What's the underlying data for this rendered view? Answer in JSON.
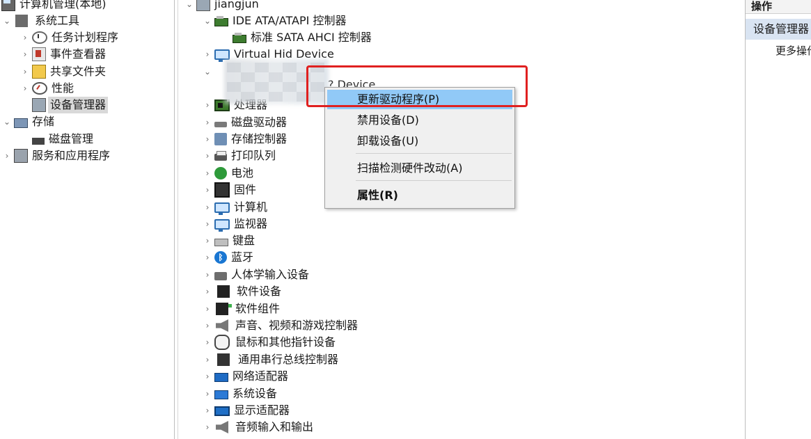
{
  "left_tree": {
    "root": "计算机管理(本地)",
    "system_tools": "系统工具",
    "task_scheduler": "任务计划程序",
    "event_viewer": "事件查看器",
    "shared_folders": "共享文件夹",
    "performance": "性能",
    "device_manager": "设备管理器",
    "storage": "存储",
    "disk_management": "磁盘管理",
    "services_apps": "服务和应用程序"
  },
  "device_tree": {
    "computer_name": "jiangjun",
    "ide_controller": "IDE ATA/ATAPI 控制器",
    "sata_controller": "标准 SATA AHCI 控制器",
    "virtual_hid": "Virtual Hid Device",
    "partial_device_text": "? Device",
    "processor_partial": "处理器",
    "categories": [
      "磁盘驱动器",
      "存储控制器",
      "打印队列",
      "电池",
      "固件",
      "计算机",
      "监视器",
      "键盘",
      "蓝牙",
      "人体学输入设备",
      "软件设备",
      "软件组件",
      "声音、视频和游戏控制器",
      "鼠标和其他指针设备",
      "通用串行总线控制器",
      "网络适配器",
      "系统设备",
      "显示适配器",
      "音频输入和输出"
    ]
  },
  "context_menu": {
    "update_driver": "更新驱动程序(P)",
    "disable_device": "禁用设备(D)",
    "uninstall_device": "卸载设备(U)",
    "scan_hardware": "扫描检测硬件改动(A)",
    "properties": "属性(R)"
  },
  "actions_pane": {
    "header": "操作",
    "section_title": "设备管理器",
    "more_actions": "更多操作"
  },
  "colors": {
    "highlight_blue": "#91c9f7",
    "selection_gray": "#d9d9d9",
    "annotation_red": "#e02020"
  }
}
